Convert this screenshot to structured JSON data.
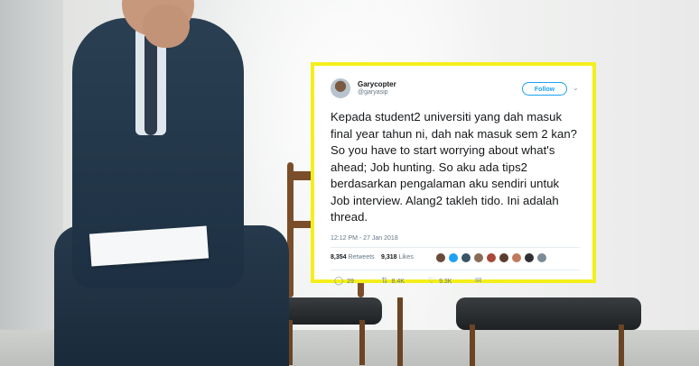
{
  "tweet": {
    "display_name": "Garycopter",
    "handle": "@garyasip",
    "follow_label": "Follow",
    "caret_icon": "chevron-down",
    "text": "Kepada student2 universiti yang dah masuk final year tahun ni, dah nak masuk sem 2 kan? So you have to start worrying about what's ahead; Job hunting. So aku ada tips2 berdasarkan pengalaman aku sendiri untuk Job interview. Alang2 takleh tido. Ini adalah thread.",
    "timestamp": "12:12 PM - 27 Jan 2018",
    "retweets_count": "8,354",
    "retweets_label": "Retweets",
    "likes_count": "9,318",
    "likes_label": "Likes",
    "replies": "29",
    "retweets_short": "8.4K",
    "likes_short": "9.3K",
    "accent": "#1da1f2",
    "frame_color": "#f4ef1b"
  }
}
